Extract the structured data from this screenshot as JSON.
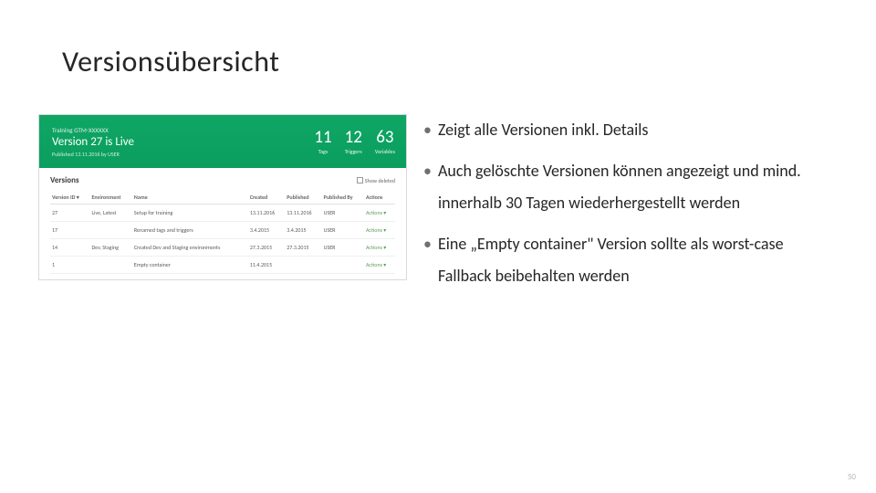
{
  "slide": {
    "title": "Versionsübersicht",
    "page_number": "50"
  },
  "bullets": [
    "Zeigt alle Versionen inkl. Details",
    "Auch gelöschte Versionen können angezeigt und mind. innerhalb 30 Tagen wiederhergestellt werden",
    "Eine „Empty container\" Version sollte als worst-case Fallback beibehalten werden"
  ],
  "screenshot": {
    "training_label": "Training GTM-XXXXXX",
    "live_line": "Version 27 is Live",
    "published_line": "Published 13.11.2016 by USER",
    "stats": [
      {
        "num": "11",
        "label": "Tags"
      },
      {
        "num": "12",
        "label": "Triggers"
      },
      {
        "num": "63",
        "label": "Variables"
      }
    ],
    "versions_title": "Versions",
    "show_deleted": "Show deleted",
    "columns": [
      "Version ID ▾",
      "Environment",
      "Name",
      "Created",
      "Published",
      "Published By",
      "Actions"
    ],
    "rows": [
      [
        "27",
        "Live, Latest",
        "Setup for training",
        "13.11.2016",
        "13.11.2016",
        "USER",
        "Actions ▾"
      ],
      [
        "17",
        "",
        "Renamed tags and triggers",
        "3.4.2015",
        "3.4.2015",
        "USER",
        "Actions ▾"
      ],
      [
        "14",
        "Dev, Staging",
        "Created Dev and Staging environments",
        "27.3.2015",
        "27.3.2015",
        "USER",
        "Actions ▾"
      ],
      [
        "1",
        "",
        "Empty container",
        "11.4.2015",
        "",
        "",
        "Actions ▾"
      ]
    ]
  }
}
